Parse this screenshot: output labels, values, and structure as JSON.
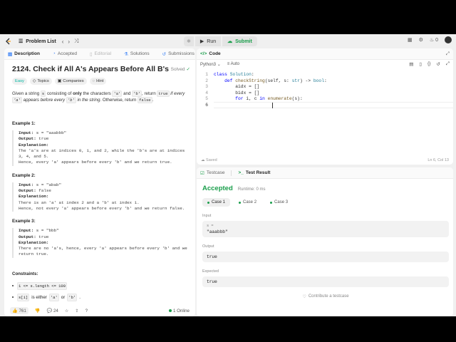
{
  "nav": {
    "problem_list": "Problem List",
    "run": "Run",
    "submit": "Submit",
    "streak": "0"
  },
  "description_panel": {
    "tabs": [
      {
        "label": "Description"
      },
      {
        "label": "Accepted"
      },
      {
        "label": "Editorial"
      },
      {
        "label": "Solutions"
      },
      {
        "label": "Submissions"
      }
    ],
    "title": "2124. Check if All A's Appears Before All B's",
    "status": "Solved",
    "tags": [
      "Easy",
      "Topics",
      "Companies",
      "Hint"
    ],
    "statement": {
      "p1": "Given a string ",
      "c1": "s",
      "p2": " consisting of ",
      "b1": "only",
      "p3": " the characters ",
      "c2": "'a'",
      "p4": " and ",
      "c3": "'b'",
      "p5": ", return ",
      "c4": "true",
      "i1": " if every ",
      "c5": "'a'",
      "i2": " appears before every ",
      "c6": "'b'",
      "i3": " in the string",
      "p6": ". Otherwise, return ",
      "c7": "false",
      "p7": "."
    },
    "examples": [
      {
        "title": "Example 1:",
        "input": "s = \"aaabbb\"",
        "output": "true",
        "explanation_lines": [
          "The 'a's are at indices 0, 1, and 2, while the 'b's are at indices",
          "3, 4, and 5.",
          "Hence, every 'a' appears before every 'b' and we return true."
        ]
      },
      {
        "title": "Example 2:",
        "input": "s = \"abab\"",
        "output": "false",
        "explanation_lines": [
          "There is an 'a' at index 2 and a 'b' at index 1.",
          "Hence, not every 'a' appears before every 'b' and we return false."
        ]
      },
      {
        "title": "Example 3:",
        "input": "s = \"bbb\"",
        "output": "true",
        "explanation_lines": [
          "There are no 'a's, hence, every 'a' appears before every 'b' and we",
          "return true."
        ]
      }
    ],
    "labels": {
      "input": "Input:",
      "output": "Output:",
      "explanation": "Explanation:"
    },
    "constraints_title": "Constraints:",
    "constraints": [
      {
        "code": "1 <= s.length <= 100",
        "text": ""
      },
      {
        "code": "s[i]",
        "text": " is either ",
        "code2": "'a'",
        "text2": " or ",
        "code3": "'b'",
        "text3": "."
      }
    ],
    "footer": {
      "likes": "761",
      "comments": "24",
      "online": "1 Online"
    }
  },
  "code_panel": {
    "title": "Code",
    "language": "Python3",
    "auto": "Auto",
    "line_numbers": [
      "1",
      "2",
      "3",
      "4",
      "5",
      "6"
    ],
    "lines": [
      [
        "class ",
        "Solution",
        ":"
      ],
      [
        "    def ",
        "checkString",
        "(self, s: ",
        "str",
        ") -> ",
        "bool",
        ":"
      ],
      [
        "        aidx = []"
      ],
      [
        "        bidx = []"
      ],
      [
        "        ",
        "for",
        " i, c ",
        "in",
        " ",
        "enumerate",
        "(s):"
      ],
      [
        ""
      ]
    ],
    "saved": "Saved",
    "cursor": "Ln 6, Col 13"
  },
  "result_panel": {
    "tabs": [
      "Testcase",
      "Test Result"
    ],
    "verdict": "Accepted",
    "runtime": "Runtime: 0 ms",
    "cases": [
      "Case 1",
      "Case 2",
      "Case 3"
    ],
    "input_label": "Input",
    "input_var": "s =",
    "input_value": "\"aaabbb\"",
    "output_label": "Output",
    "output_value": "true",
    "expected_label": "Expected",
    "expected_value": "true",
    "contribute": "Contribute a testcase"
  },
  "colors": {
    "accepted": "#1a9e4b",
    "easy": "#00b8a3",
    "keyword": "#0000ff"
  }
}
